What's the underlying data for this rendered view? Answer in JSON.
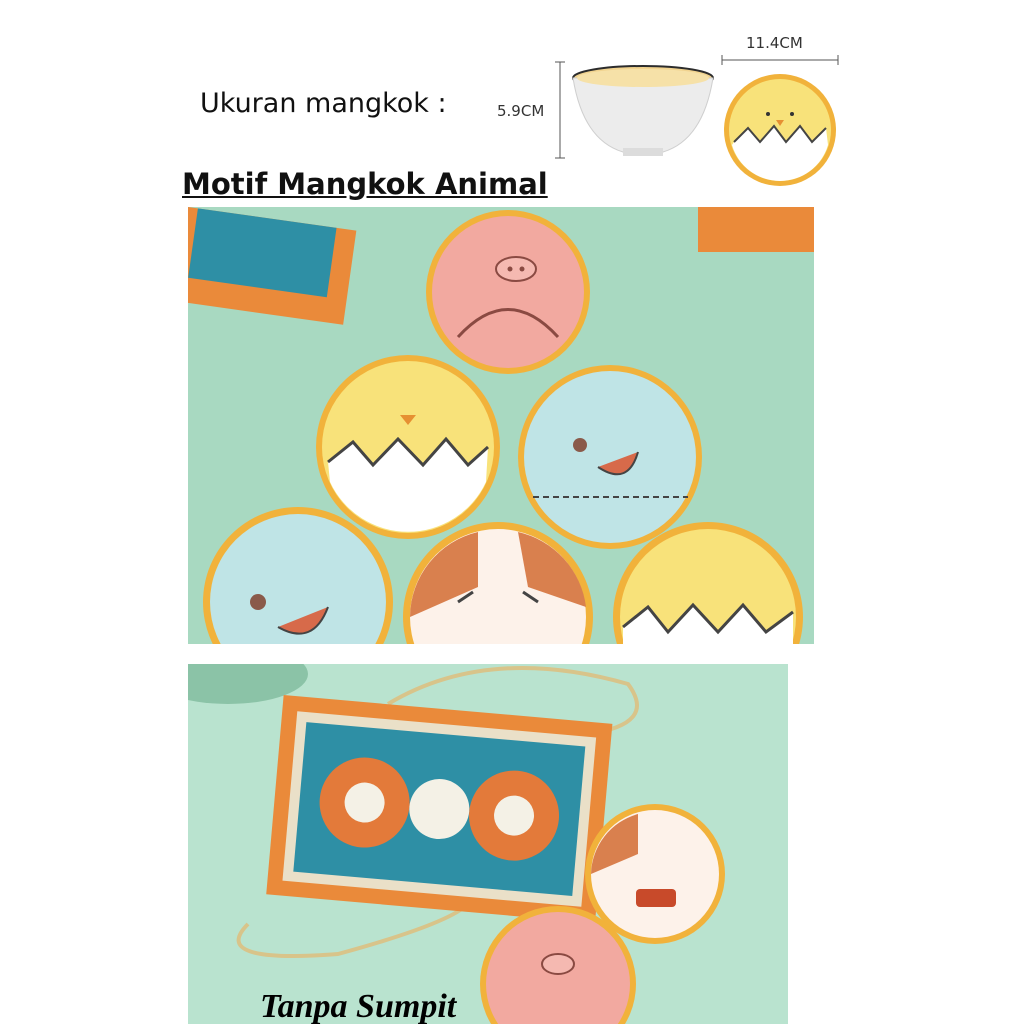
{
  "size_section": {
    "label": "Ukuran mangkok :",
    "height": "5.9CM",
    "diameter": "11.4CM"
  },
  "motif_title": "Motif Mangkok Animal",
  "caption": "Tanpa Sumpit",
  "colors": {
    "background_mint": "#a8d9c1",
    "bowl_rim": "#e9a63a",
    "pig_pink": "#f2a9a0",
    "chick_yellow": "#f7dc6f",
    "elephant_blue": "#bfe4e6",
    "cat_orange": "#d9804e",
    "box_orange": "#ea8a3a"
  },
  "icons": [
    "pig-bowl-icon",
    "chick-bowl-icon",
    "elephant-bowl-icon",
    "cat-bowl-icon",
    "gift-box-icon"
  ]
}
